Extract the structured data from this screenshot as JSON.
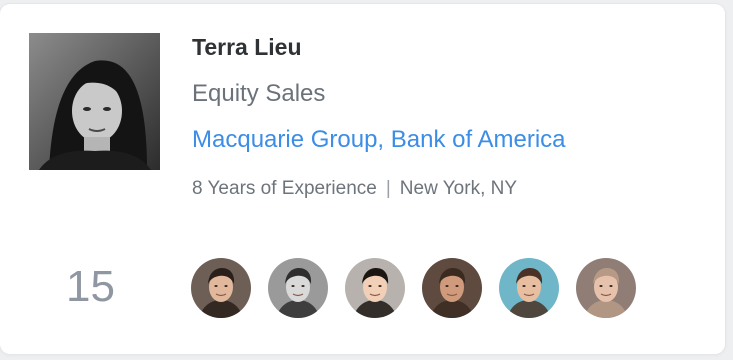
{
  "profile": {
    "name": "Terra Lieu",
    "title": "Equity Sales",
    "companies": "Macquarie Group, Bank of America",
    "experience": "8 Years of Experience",
    "separator": "|",
    "location": "New York, NY"
  },
  "connections": {
    "count": "15",
    "avatars": [
      {
        "bg": "#6d5f55",
        "skin": "#e2b89c",
        "hair": "#2a1f1a"
      },
      {
        "bg": "#9a9a9a",
        "skin": "#d9d9d9",
        "hair": "#2e2e2e"
      },
      {
        "bg": "#b7b2ad",
        "skin": "#f1d0b7",
        "hair": "#1c1613"
      },
      {
        "bg": "#5e4a3e",
        "skin": "#d09a7c",
        "hair": "#3a2a20"
      },
      {
        "bg": "#6fb6c9",
        "skin": "#e8bea0",
        "hair": "#4a3326"
      },
      {
        "bg": "#8f7d76",
        "skin": "#e6c2ad",
        "hair": "#b79a86"
      }
    ]
  },
  "colors": {
    "accent": "#3b8de6",
    "name": "#2f3336",
    "muted": "#6b727a",
    "count": "#8f97a3"
  }
}
